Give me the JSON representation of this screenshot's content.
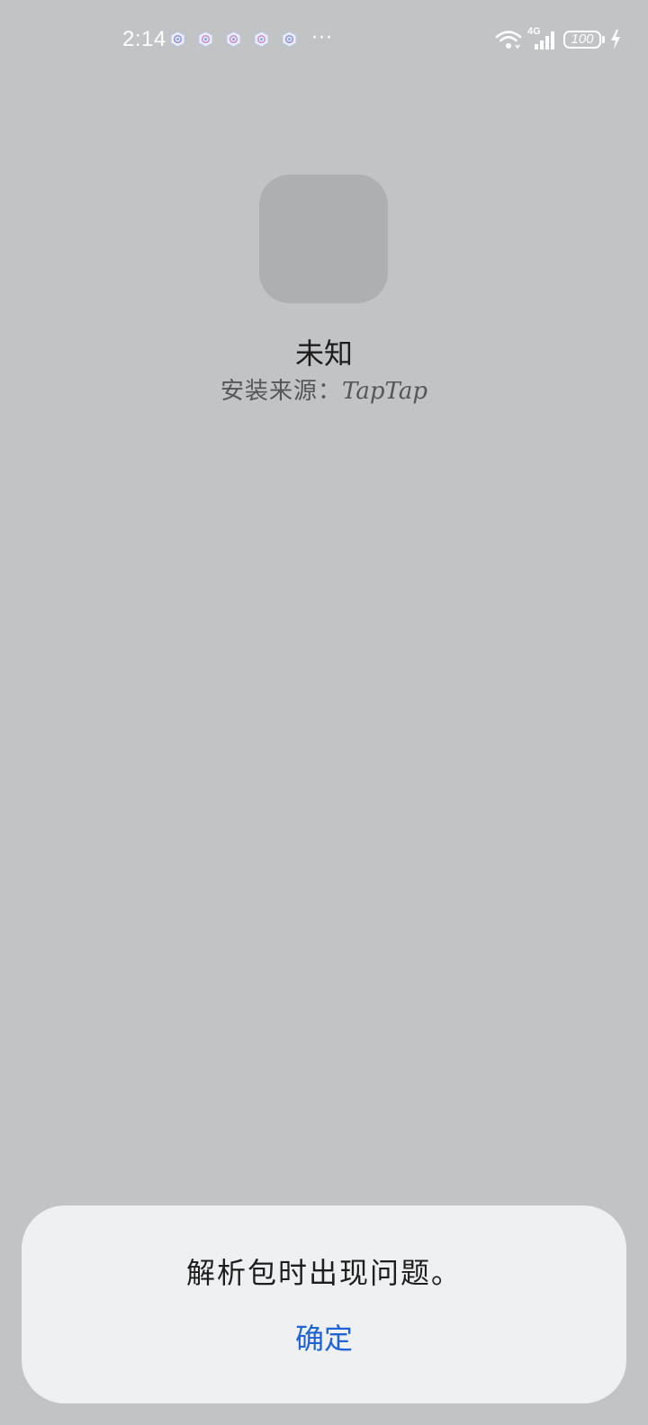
{
  "status_bar": {
    "time": "2:14",
    "more": "···",
    "network_label": "4G",
    "battery_level": "100",
    "notification_icons": [
      "app-notification-icon",
      "app-notification-icon",
      "app-notification-icon",
      "app-notification-icon",
      "app-notification-icon"
    ]
  },
  "app": {
    "name": "未知",
    "source_label": "安装来源：",
    "source_value": "TapTap"
  },
  "dialog": {
    "message": "解析包时出现问题。",
    "confirm_label": "确定",
    "accent_color": "#1f63d4"
  }
}
